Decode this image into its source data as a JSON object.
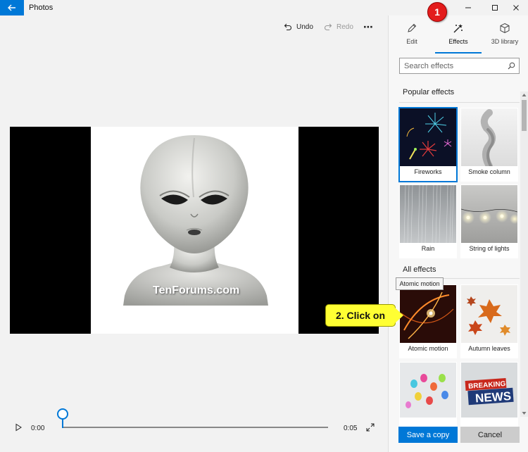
{
  "window": {
    "title": "Photos",
    "back_icon": "arrow-left-icon",
    "controls": [
      "minimize-icon",
      "maximize-icon",
      "close-icon"
    ]
  },
  "toolbar": {
    "undo_label": "Undo",
    "redo_label": "Redo",
    "more_icon": "more-icon"
  },
  "viewer": {
    "watermark": "TenForums.com"
  },
  "playback": {
    "current_time": "0:00",
    "duration": "0:05",
    "progress": 0
  },
  "panel": {
    "tabs": [
      {
        "label": "Edit",
        "icon": "pencil-icon"
      },
      {
        "label": "Effects",
        "icon": "effects-icon",
        "active": true
      },
      {
        "label": "3D library",
        "icon": "cube-icon"
      }
    ],
    "search": {
      "placeholder": "Search effects"
    },
    "popular_title": "Popular effects",
    "popular": [
      {
        "label": "Fireworks",
        "selected": true
      },
      {
        "label": "Smoke column"
      },
      {
        "label": "Rain"
      },
      {
        "label": "String of lights"
      }
    ],
    "all_title": "All effects",
    "all": [
      {
        "label": "Atomic motion"
      },
      {
        "label": "Autumn leaves"
      },
      {
        "label": ""
      },
      {
        "label": ""
      }
    ],
    "tooltip": "Atomic motion",
    "save_label": "Save a copy",
    "cancel_label": "Cancel"
  },
  "annotations": {
    "step1": "1",
    "step2": "2. Click on"
  },
  "thumb_texts": {
    "breaking": "BREAKING",
    "news": "NEWS"
  },
  "colors": {
    "accent": "#0078d7",
    "badge": "#e31c1c",
    "callout": "#ffff33"
  }
}
